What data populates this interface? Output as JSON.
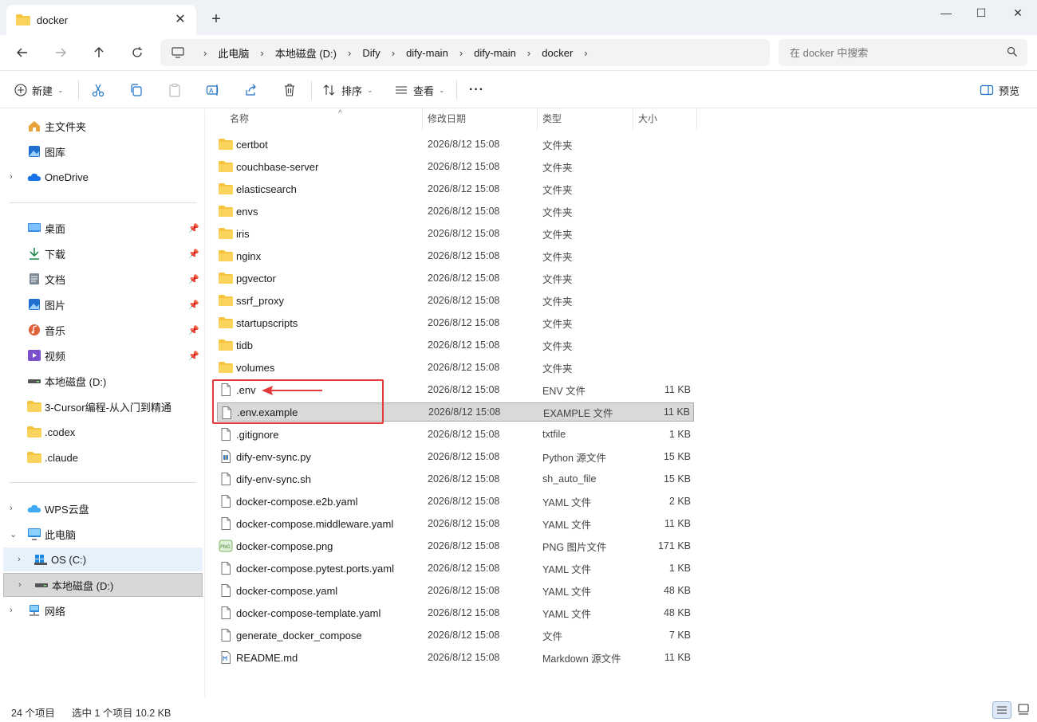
{
  "window": {
    "tab_title": "docker",
    "close_tab": "✕",
    "new_tab": "+",
    "minimize": "—",
    "maximize": "☐",
    "close": "✕"
  },
  "nav": {
    "breadcrumbs": [
      "此电脑",
      "本地磁盘 (D:)",
      "Dify",
      "dify-main",
      "dify-main",
      "docker"
    ],
    "search_placeholder": "在 docker 中搜索"
  },
  "toolbar": {
    "new_label": "新建",
    "sort_label": "排序",
    "view_label": "查看",
    "more_label": "···",
    "preview_label": "预览"
  },
  "sidebar": {
    "quick": [
      {
        "label": "主文件夹",
        "icon": "home-icon"
      },
      {
        "label": "图库",
        "icon": "gallery-icon"
      },
      {
        "label": "OneDrive",
        "icon": "cloud-icon"
      }
    ],
    "pinned": [
      {
        "label": "桌面",
        "icon": "desktop-icon"
      },
      {
        "label": "下载",
        "icon": "download-icon"
      },
      {
        "label": "文档",
        "icon": "document-icon"
      },
      {
        "label": "图片",
        "icon": "picture-icon"
      },
      {
        "label": "音乐",
        "icon": "music-icon"
      },
      {
        "label": "视频",
        "icon": "video-icon"
      },
      {
        "label": "本地磁盘 (D:)",
        "icon": "drive-icon"
      },
      {
        "label": "3-Cursor编程-从入门到精通",
        "icon": "folder-icon"
      },
      {
        "label": ".codex",
        "icon": "folder-icon"
      },
      {
        "label": ".claude",
        "icon": "folder-icon"
      }
    ],
    "tree": [
      {
        "label": "WPS云盘",
        "icon": "cloud-icon"
      },
      {
        "label": "此电脑",
        "icon": "computer-icon"
      },
      {
        "label": "OS (C:)",
        "icon": "windows-drive-icon"
      },
      {
        "label": "本地磁盘 (D:)",
        "icon": "drive-icon"
      },
      {
        "label": "网络",
        "icon": "network-icon"
      }
    ]
  },
  "columns": {
    "name": "名称",
    "date": "修改日期",
    "type": "类型",
    "size": "大小"
  },
  "files": [
    {
      "name": "certbot",
      "date": "2026/8/12 15:08",
      "type": "文件夹",
      "size": "",
      "kind": "folder"
    },
    {
      "name": "couchbase-server",
      "date": "2026/8/12 15:08",
      "type": "文件夹",
      "size": "",
      "kind": "folder"
    },
    {
      "name": "elasticsearch",
      "date": "2026/8/12 15:08",
      "type": "文件夹",
      "size": "",
      "kind": "folder"
    },
    {
      "name": "envs",
      "date": "2026/8/12 15:08",
      "type": "文件夹",
      "size": "",
      "kind": "folder"
    },
    {
      "name": "iris",
      "date": "2026/8/12 15:08",
      "type": "文件夹",
      "size": "",
      "kind": "folder"
    },
    {
      "name": "nginx",
      "date": "2026/8/12 15:08",
      "type": "文件夹",
      "size": "",
      "kind": "folder"
    },
    {
      "name": "pgvector",
      "date": "2026/8/12 15:08",
      "type": "文件夹",
      "size": "",
      "kind": "folder"
    },
    {
      "name": "ssrf_proxy",
      "date": "2026/8/12 15:08",
      "type": "文件夹",
      "size": "",
      "kind": "folder"
    },
    {
      "name": "startupscripts",
      "date": "2026/8/12 15:08",
      "type": "文件夹",
      "size": "",
      "kind": "folder"
    },
    {
      "name": "tidb",
      "date": "2026/8/12 15:08",
      "type": "文件夹",
      "size": "",
      "kind": "folder"
    },
    {
      "name": "volumes",
      "date": "2026/8/12 15:08",
      "type": "文件夹",
      "size": "",
      "kind": "folder"
    },
    {
      "name": ".env",
      "date": "2026/8/12 15:08",
      "type": "ENV 文件",
      "size": "11 KB",
      "kind": "file"
    },
    {
      "name": ".env.example",
      "date": "2026/8/12 15:08",
      "type": "EXAMPLE 文件",
      "size": "11 KB",
      "kind": "file",
      "selected": true
    },
    {
      "name": ".gitignore",
      "date": "2026/8/12 15:08",
      "type": "txtfile",
      "size": "1 KB",
      "kind": "file"
    },
    {
      "name": "dify-env-sync.py",
      "date": "2026/8/12 15:08",
      "type": "Python 源文件",
      "size": "15 KB",
      "kind": "python"
    },
    {
      "name": "dify-env-sync.sh",
      "date": "2026/8/12 15:08",
      "type": "sh_auto_file",
      "size": "15 KB",
      "kind": "file"
    },
    {
      "name": "docker-compose.e2b.yaml",
      "date": "2026/8/12 15:08",
      "type": "YAML 文件",
      "size": "2 KB",
      "kind": "file"
    },
    {
      "name": "docker-compose.middleware.yaml",
      "date": "2026/8/12 15:08",
      "type": "YAML 文件",
      "size": "11 KB",
      "kind": "file"
    },
    {
      "name": "docker-compose.png",
      "date": "2026/8/12 15:08",
      "type": "PNG 图片文件",
      "size": "171 KB",
      "kind": "png"
    },
    {
      "name": "docker-compose.pytest.ports.yaml",
      "date": "2026/8/12 15:08",
      "type": "YAML 文件",
      "size": "1 KB",
      "kind": "file"
    },
    {
      "name": "docker-compose.yaml",
      "date": "2026/8/12 15:08",
      "type": "YAML 文件",
      "size": "48 KB",
      "kind": "file"
    },
    {
      "name": "docker-compose-template.yaml",
      "date": "2026/8/12 15:08",
      "type": "YAML 文件",
      "size": "48 KB",
      "kind": "file"
    },
    {
      "name": "generate_docker_compose",
      "date": "2026/8/12 15:08",
      "type": "文件",
      "size": "7 KB",
      "kind": "file"
    },
    {
      "name": "README.md",
      "date": "2026/8/12 15:08",
      "type": "Markdown 源文件",
      "size": "11 KB",
      "kind": "markdown"
    }
  ],
  "status": {
    "count": "24 个项目",
    "selection": "选中 1 个项目  10.2 KB"
  },
  "colors": {
    "accent": "#0067c0",
    "folder": "#f5c542",
    "annotation": "#e33b3b"
  }
}
